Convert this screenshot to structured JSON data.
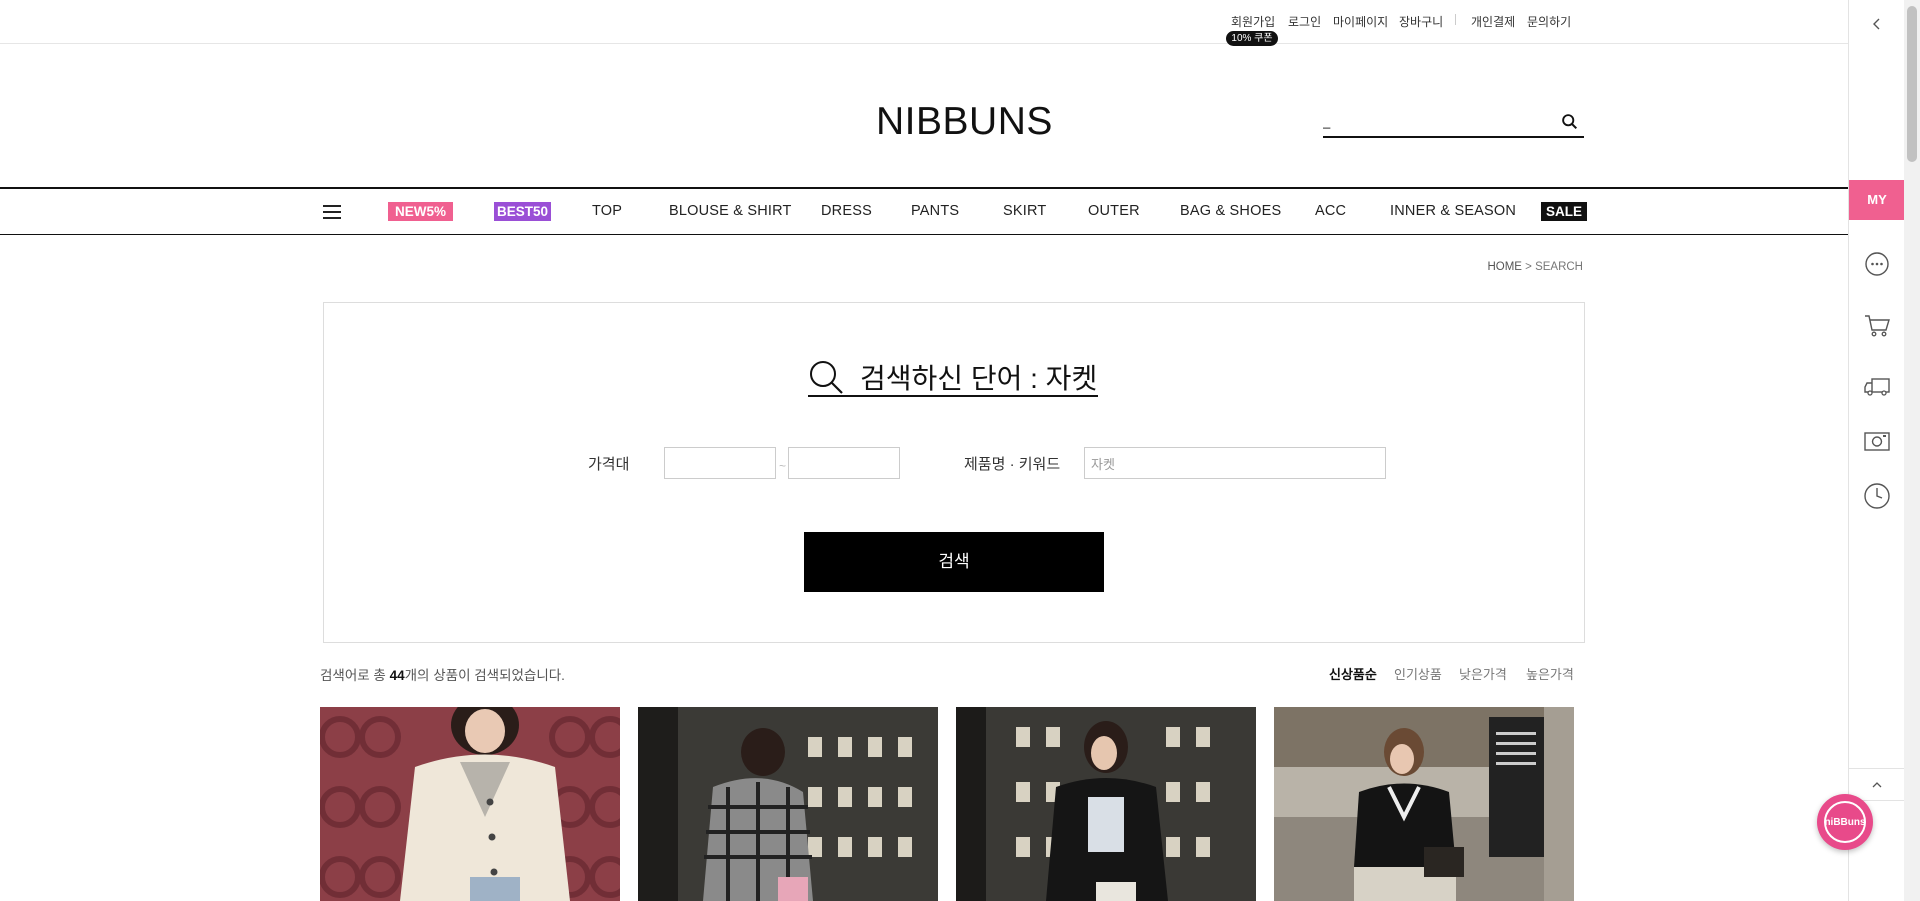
{
  "topbar": {
    "links": [
      "회원가입",
      "로그인",
      "마이페이지",
      "장바구니",
      "개인결제",
      "문의하기"
    ],
    "coupon_badge": "10% 쿠폰"
  },
  "header": {
    "logo": "NIBBUNS",
    "search_value": "_"
  },
  "nav": {
    "badges": [
      {
        "label": "NEW5%",
        "color": "#f06090"
      },
      {
        "label": "BEST50",
        "color": "#9a4fd6"
      },
      {
        "label": "SALE",
        "color": "#111111"
      }
    ],
    "items": [
      "TOP",
      "BLOUSE & SHIRT",
      "DRESS",
      "PANTS",
      "SKIRT",
      "OUTER",
      "BAG & SHOES",
      "ACC",
      "INNER & SEASON"
    ]
  },
  "breadcrumb": {
    "home": "HOME",
    "sep": ">",
    "current": "SEARCH"
  },
  "search_panel": {
    "title": "검색하신 단어 : 자켓",
    "price_label": "가격대",
    "price_sep": "~",
    "keyword_label": "제품명 · 키워드",
    "keyword_value": "자켓",
    "button": "검색"
  },
  "results": {
    "prefix": "검색어로 총 ",
    "count": "44",
    "suffix": "개의 상품이 검색되었습니다.",
    "sort_options": [
      "신상품순",
      "인기상품",
      "낮은가격",
      "높은가격"
    ],
    "active_sort": "신상품순"
  },
  "quickbar": {
    "my_label": "MY",
    "accent": "#f06090"
  },
  "chat": {
    "label": "niBBuns"
  }
}
